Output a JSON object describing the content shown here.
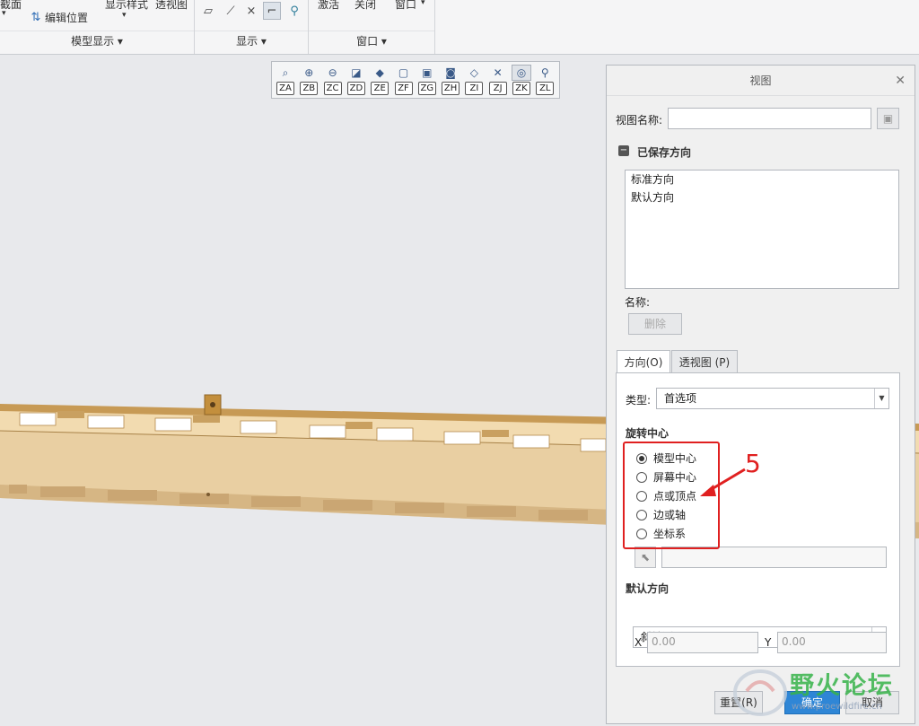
{
  "ribbon": {
    "partial_top_label": "截面",
    "edit_position": "编辑位置",
    "display_style": "显示样式",
    "perspective": "透视图",
    "activate": "激活",
    "close": "关闭",
    "window_menu": "窗口",
    "group_model_display": "模型显示 ▾",
    "group_display": "显示 ▾",
    "group_window": "窗口 ▾"
  },
  "view_toolbar": {
    "items": [
      {
        "tag": "ZA",
        "icon": "zoom-fit-icon"
      },
      {
        "tag": "ZB",
        "icon": "zoom-in-icon"
      },
      {
        "tag": "ZC",
        "icon": "zoom-out-icon"
      },
      {
        "tag": "ZD",
        "icon": "refit-icon"
      },
      {
        "tag": "ZE",
        "icon": "shaded-icon"
      },
      {
        "tag": "ZF",
        "icon": "standard-orientation-icon"
      },
      {
        "tag": "ZG",
        "icon": "saved-orientation-icon"
      },
      {
        "tag": "ZH",
        "icon": "camera-icon"
      },
      {
        "tag": "ZI",
        "icon": "display-style-icon"
      },
      {
        "tag": "ZJ",
        "icon": "datum-display-icon"
      },
      {
        "tag": "ZK",
        "icon": "spin-center-icon"
      },
      {
        "tag": "ZL",
        "icon": "annotation-icon"
      }
    ]
  },
  "dialog": {
    "title": "视图",
    "view_name_label": "视图名称:",
    "view_name_value": "",
    "saved_orientations_title": "已保存方向",
    "saved_orientations": [
      "标准方向",
      "默认方向"
    ],
    "name_label": "名称:",
    "delete_button": "删除",
    "tabs": [
      "方向(O)",
      "透视图 (P)"
    ],
    "type_label": "类型:",
    "type_value": "首选项",
    "spin_center_title": "旋转中心",
    "spin_center_options": [
      {
        "label": "模型中心",
        "checked": true
      },
      {
        "label": "屏幕中心",
        "checked": false
      },
      {
        "label": "点或顶点",
        "checked": false
      },
      {
        "label": "边或轴",
        "checked": false
      },
      {
        "label": "坐标系",
        "checked": false
      }
    ],
    "default_orientation_title": "默认方向",
    "default_orientation_value": "斜轴测",
    "x_label": "X",
    "x_value": "0.00",
    "y_label": "Y",
    "y_value": "0.00",
    "reset_button": "重置(R)",
    "ok_button": "确定",
    "cancel_button": "取消"
  },
  "annotation": {
    "number": "5",
    "color": "#e02020"
  },
  "watermark": {
    "text": "野火论坛",
    "url": "www.proewildfire.cn"
  },
  "colors": {
    "part_body": "#e9cfa2",
    "part_dark": "#b98f53",
    "accent_red": "#e02020"
  }
}
